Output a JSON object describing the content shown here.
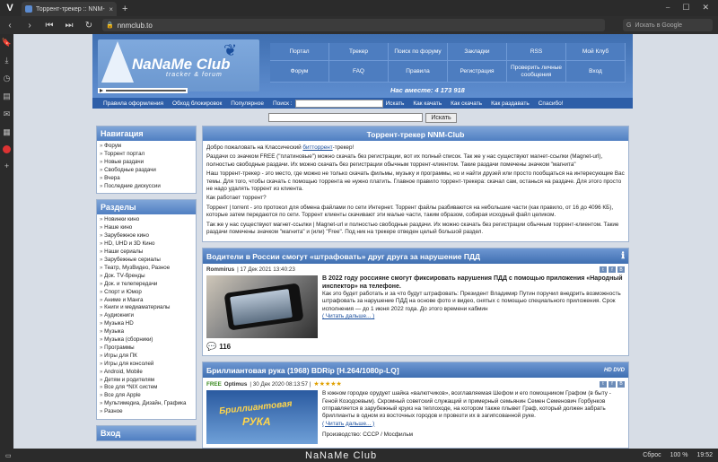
{
  "browser": {
    "tab_title": "Торрент-трекер :: NNM-C",
    "tab_close": "×",
    "new_tab": "+",
    "window_controls": [
      "⎯",
      "☐",
      "✕"
    ],
    "url": "nnmclub.to",
    "search_placeholder": "Искать в Google",
    "status_brand": "NaNaMe Club",
    "status_reset": "Сброс",
    "zoom": "100 %",
    "clock": "19:52"
  },
  "header": {
    "brand_name": "NaNaMe Club",
    "brand_sub": "tracker & forum",
    "together": "Нас вместе: 4 173 918",
    "nav": [
      "Портал",
      "Трекер",
      "Поиск по форуму",
      "Закладки",
      "RSS",
      "Мой Клуб",
      "Форум",
      "FAQ",
      "Правила",
      "Регистрация",
      "Проверить личные сообщения",
      "Вход"
    ]
  },
  "menubar": {
    "items_left": [
      "Правила оформления",
      "Обход блокировок",
      "Популярное"
    ],
    "search_label": "Поиск :",
    "search_btn": "Искать",
    "items_right": [
      "Как качать",
      "Как скачать",
      "Как раздавать",
      "Спасибо!"
    ]
  },
  "search": {
    "button": "Искать"
  },
  "sidebar": {
    "nav_title": "Навигация",
    "nav_items": [
      "Форум",
      "Торрент портал",
      "Новые раздачи",
      "Свободные раздачи",
      "Вчера",
      "Последние дискуссии"
    ],
    "sections_title": "Разделы",
    "sections": [
      "Новинки кино",
      "Наше кино",
      "Зарубежное кино",
      "HD, UHD и 3D Кино",
      "Наши сериалы",
      "Зарубежные сериалы",
      "Театр, МузВидео, Разное",
      "Док. TV-бренды",
      "Док. и телепередачи",
      "Спорт и Юмор",
      "Аниме и Манга",
      "Книги и медиаматериалы",
      "Аудиокниги",
      "Музыка HD",
      "Музыка",
      "Музыка (сборники)",
      "Программы",
      "Игры для ПК",
      "Игры для консолей",
      "Android, Mobile",
      "Детям и родителям",
      "Все для *NIX систем",
      "Все для Apple",
      "Мультимедиа, Дизайн, Графика",
      "Разное"
    ],
    "login_title": "Вход"
  },
  "welcome": {
    "title": "Торрент-трекер NNM-Club",
    "p1_a": "Добро пожаловать на Классический ",
    "p1_link": "битторрент",
    "p1_b": "-трекер!",
    "p2": "Раздачи со значком FREE (\"платиновые\") можно скачать без регистрации, вот их полный список. Так же у нас существуют магнет-ссылки (Magnet-url), полностью свободные раздачи. Их можно скачать без регистрации обычным торрент-клиентом. Такие раздачи помечены значком \"магнита\"",
    "p3": "Наш торрент-трекер - это место, где можно не только скачать фильмы, музыку и программы, но и найти друзей или просто пообщаться на интересующие Вас темы. Для того, чтобы скачать с помощью торрента не нужно платить. Главное правило торрент-трекера: скачал сам, останься на раздаче. Для этого просто не надо удалять торрент из клиента.",
    "p4": "Как работает торрент?",
    "p5": "Торрент | torrent - это протокол для обмена файлами по сети Интернет. Торрент файлы разбиваются на небольшие части (как правило, от 16 до 4096 КБ), которые затем передаются по сети. Торрент клиенты скачивают эти малые части, таким образом, собирая исходный файл целиком.",
    "p6": "Так же у нас существуют магнет-ссылки | Magnet-url и полностью свободные раздачи. Их можно скачать без регистрации обычным торрент-клиентом. Такие раздачи помечены значком \"магнита\" и (или) \"Free\". Под ник на трекере отведен целый большой раздел."
  },
  "news": [
    {
      "title": "Водители в России смогут «штрафовать» друг друга за нарушение ПДД",
      "author": "Rommirus",
      "date": "| 17 Дек 2021 13:40:23",
      "headline": "В 2022 году россияне смогут фиксировать нарушения ПДД с помощью приложения «Народный инспектор» на телефоне.",
      "body": "Как это будет работать и за что будут штрафовать: Президент Владимир Путин поручил внедрить возможность штрафовать за нарушение ПДД на основе фото и видео, снятых с помощью специального приложения. Срок исполнения — до 1 июня 2022 года. До этого времени кабмин",
      "more": "( Читать дальше... )",
      "comments": "116"
    },
    {
      "title": "Бриллиантовая рука (1968) BDRip [H.264/1080p-LQ]",
      "free": "FREE",
      "author": "Optimus",
      "date": "| 30 Дек 2020 08:13:57 |",
      "stars": "★★★★★",
      "hd": "HD DVD",
      "body": "В южном городке орудует шайка «валютчиков», возглавляемая Шефом и его помощником Графом (в быту - Геной Козодоевым). Скромный советский служащий и примерный семьянин Семен Семенович Горбунков отправляется в зарубежный круиз на теплоходе, на котором также плывет Граф, который должен забрать бриллианты в одном из восточных городов и провезти их в загипсованной руке.",
      "more": "( Читать дальше... )",
      "production": "Производство: СССР / Мосфильм",
      "poster_t1": "Бриллиантовая",
      "poster_t2": "РУКА"
    }
  ]
}
